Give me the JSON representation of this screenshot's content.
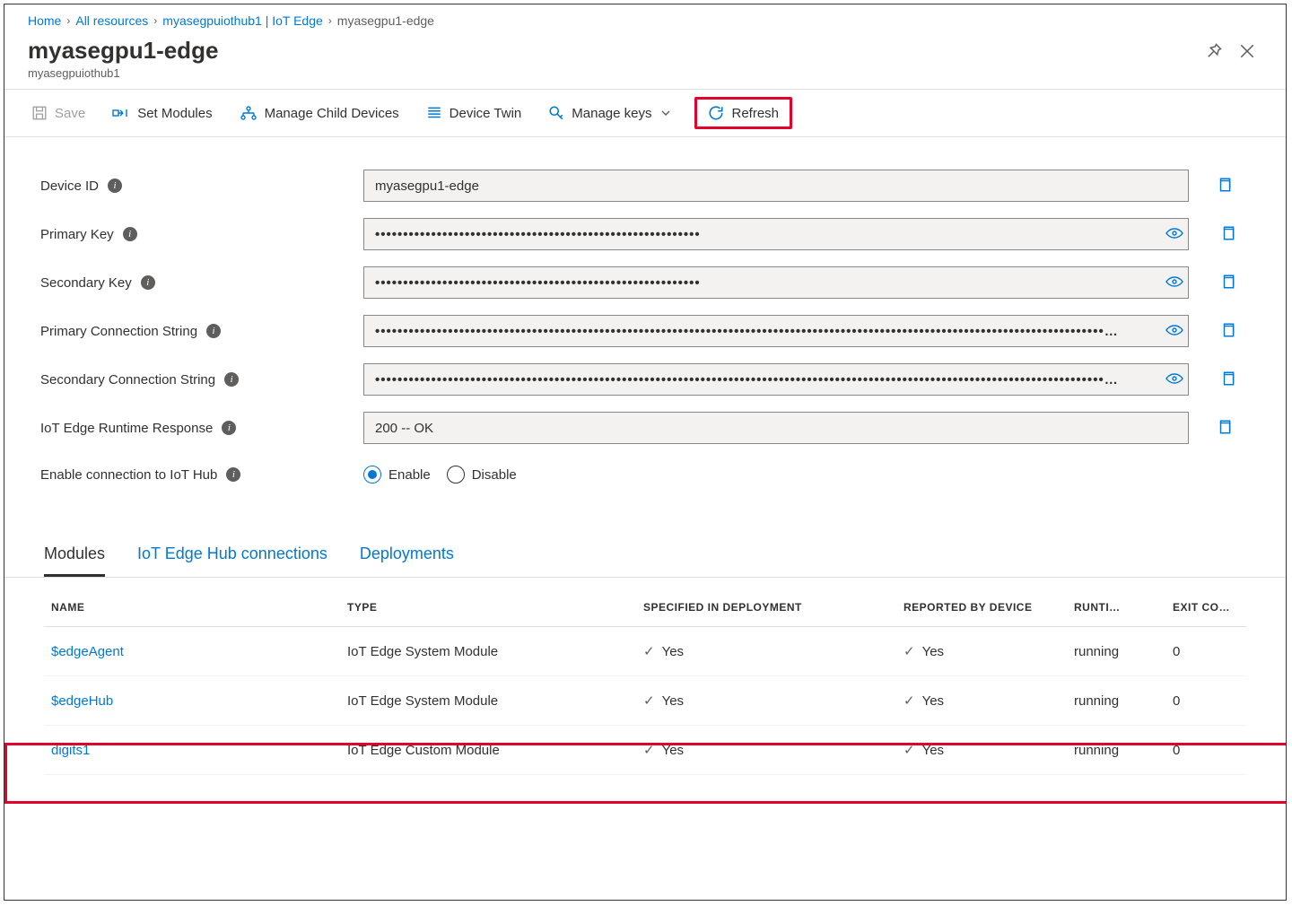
{
  "breadcrumb": {
    "items": [
      {
        "label": "Home",
        "link": true
      },
      {
        "label": "All resources",
        "link": true
      },
      {
        "label": "myasegpuiothub1 | IoT Edge",
        "link": true
      },
      {
        "label": "myasegpu1-edge",
        "link": false
      }
    ]
  },
  "header": {
    "title": "myasegpu1-edge",
    "subtitle": "myasegpuiothub1"
  },
  "toolbar": {
    "save": "Save",
    "set_modules": "Set Modules",
    "manage_child": "Manage Child Devices",
    "device_twin": "Device Twin",
    "manage_keys": "Manage keys",
    "refresh": "Refresh"
  },
  "form": {
    "device_id": {
      "label": "Device ID",
      "value": "myasegpu1-edge"
    },
    "primary_key": {
      "label": "Primary Key",
      "value": "••••••••••••••••••••••••••••••••••••••••••••••••••••••••••"
    },
    "secondary_key": {
      "label": "Secondary Key",
      "value": "••••••••••••••••••••••••••••••••••••••••••••••••••••••••••"
    },
    "primary_conn": {
      "label": "Primary Connection String",
      "value": "••••••••••••••••••••••••••••••••••••••••••••••••••••••••••••••••••••••••••••••••••••••••••••••••••••••••••••••••••••••••••••••••••…"
    },
    "secondary_conn": {
      "label": "Secondary Connection String",
      "value": "••••••••••••••••••••••••••••••••••••••••••••••••••••••••••••••••••••••••••••••••••••••••••••••••••••••••••••••••••••••••••••••••••…"
    },
    "runtime_response": {
      "label": "IoT Edge Runtime Response",
      "value": "200 -- OK"
    },
    "enable_conn": {
      "label": "Enable connection to IoT Hub",
      "enable": "Enable",
      "disable": "Disable"
    }
  },
  "tabs": {
    "modules": "Modules",
    "connections": "IoT Edge Hub connections",
    "deployments": "Deployments"
  },
  "table": {
    "headers": {
      "name": "NAME",
      "type": "TYPE",
      "specified": "SPECIFIED IN DEPLOYMENT",
      "reported": "REPORTED BY DEVICE",
      "runtime": "RUNTI…",
      "exit": "EXIT CO…"
    },
    "rows": [
      {
        "name": "$edgeAgent",
        "type": "IoT Edge System Module",
        "specified": "Yes",
        "reported": "Yes",
        "runtime": "running",
        "exit": "0"
      },
      {
        "name": "$edgeHub",
        "type": "IoT Edge System Module",
        "specified": "Yes",
        "reported": "Yes",
        "runtime": "running",
        "exit": "0"
      },
      {
        "name": "digits1",
        "type": "IoT Edge Custom Module",
        "specified": "Yes",
        "reported": "Yes",
        "runtime": "running",
        "exit": "0"
      }
    ]
  }
}
